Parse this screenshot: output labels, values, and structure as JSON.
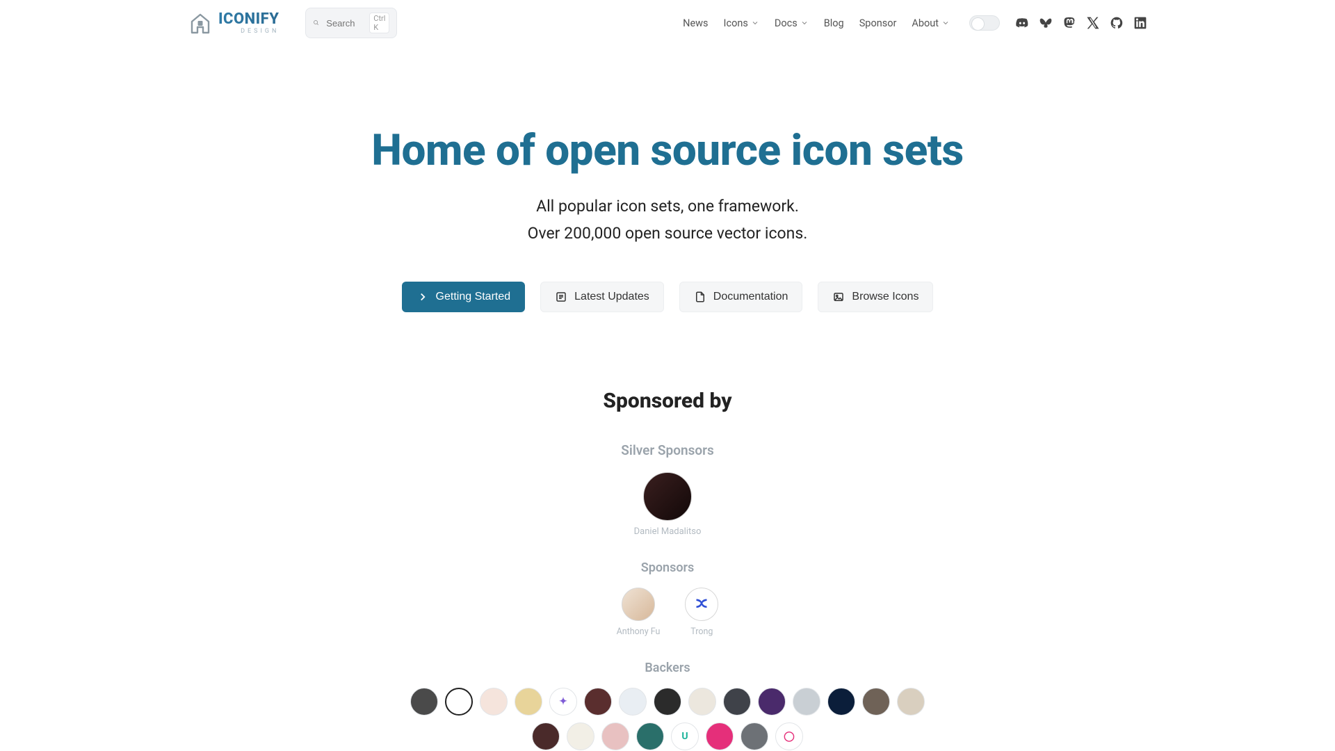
{
  "header": {
    "logo_main": "iCONiFY",
    "logo_sub": "DESIGN",
    "search_placeholder": "Search",
    "search_kbd": "Ctrl K",
    "nav": {
      "news": "News",
      "icons": "Icons",
      "docs": "Docs",
      "blog": "Blog",
      "sponsor": "Sponsor",
      "about": "About"
    }
  },
  "hero": {
    "title": "Home of open source icon sets",
    "sub1": "All popular icon sets, one framework.",
    "sub2": "Over 200,000 open source vector icons.",
    "cta": {
      "getting_started": "Getting Started",
      "latest_updates": "Latest Updates",
      "documentation": "Documentation",
      "browse_icons": "Browse Icons"
    }
  },
  "sponsors": {
    "heading": "Sponsored by",
    "silver_label": "Silver Sponsors",
    "silver": {
      "name": "Daniel Madalitso"
    },
    "sponsors_label": "Sponsors",
    "items": [
      {
        "name": "Anthony Fu"
      },
      {
        "name": "Trong"
      }
    ],
    "backers_label": "Backers",
    "backers_line1": [
      {
        "bg": "#4a4a4a"
      },
      {
        "bg": "#ffffff",
        "stroke": "#222"
      },
      {
        "bg": "#f5e4dc"
      },
      {
        "bg": "#e8d49a"
      },
      {
        "bg": "#ffffff",
        "letter": "✦",
        "color": "#7e5bd6"
      },
      {
        "bg": "#5a2e2e"
      },
      {
        "bg": "#e9eef3"
      },
      {
        "bg": "#2b2b2b"
      },
      {
        "bg": "#ece7de"
      },
      {
        "bg": "#3f4249"
      },
      {
        "bg": "#4a2a6b"
      },
      {
        "bg": "#c9cfd4"
      },
      {
        "bg": "#0b1e3a"
      },
      {
        "bg": "#6f6257"
      },
      {
        "bg": "#d9cfbf"
      }
    ],
    "backers_line2": [
      {
        "bg": "#4a2a2a"
      },
      {
        "bg": "#f2efe6"
      },
      {
        "bg": "#e8c1c1"
      },
      {
        "bg": "#2a6f6a"
      },
      {
        "bg": "#ffffff",
        "letter": "U",
        "color": "#1bb39a"
      },
      {
        "bg": "#e52f7a"
      },
      {
        "bg": "#6d7176"
      },
      {
        "bg": "#ffffff",
        "letter": "◯",
        "color": "#e52f7a"
      }
    ]
  },
  "icons": {
    "search": "search-icon",
    "chevron_down": "chevron-down-icon",
    "discord": "discord-icon",
    "butterfly": "butterfly-icon",
    "mastodon": "mastodon-icon",
    "x": "x-icon",
    "github": "github-icon",
    "linkedin": "linkedin-icon",
    "chevron_right": "chevron-right-icon",
    "list": "list-icon",
    "file": "file-icon",
    "image": "image-icon"
  }
}
